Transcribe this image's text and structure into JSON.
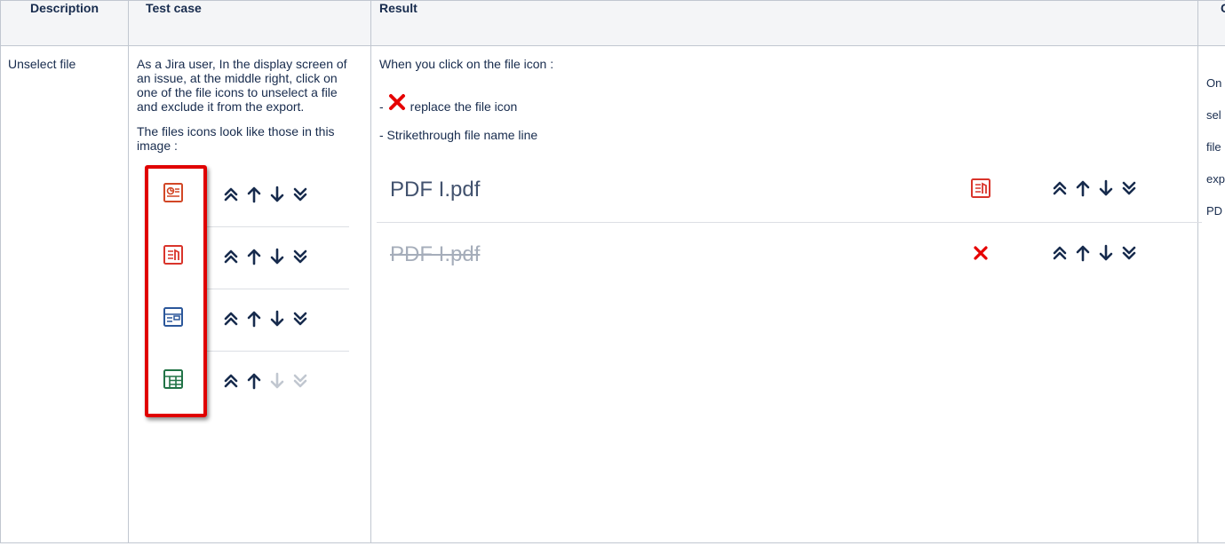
{
  "table": {
    "headers": [
      "Description",
      "Test case",
      "Result",
      "C"
    ],
    "row": {
      "description": "Unselect file",
      "test_case": {
        "paragraph1": "As a Jira user, In the display screen of an issue, at the middle right, click on one of the file icons to unselect a file and exclude it from the export.",
        "paragraph2": "The files icons look like those in this image :",
        "example_icons": [
          "ppt-file-icon",
          "pdf-file-icon",
          "doc-file-icon",
          "xls-file-icon"
        ],
        "last_row_disabled": [
          "move-down-icon",
          "move-bottom-icon"
        ]
      },
      "result": {
        "intro": "When you click on the file icon :",
        "dash": "-",
        "x_text": "replace the file icon",
        "strike_text": "- Strikethrough file name line",
        "file_before": "PDF I.pdf",
        "file_after": "PDF I.pdf"
      },
      "clipped": [
        "On",
        "sel",
        "file",
        "exp",
        "PD"
      ]
    }
  },
  "colors": {
    "header_bg": "#f4f5f7",
    "border": "#c1c7d0",
    "red_box": "#e00000",
    "x_red": "#e60000",
    "pdf_icon": "#d9342b",
    "ppt_icon": "#d24726",
    "doc_icon": "#2b579a",
    "xls_icon": "#217346"
  }
}
